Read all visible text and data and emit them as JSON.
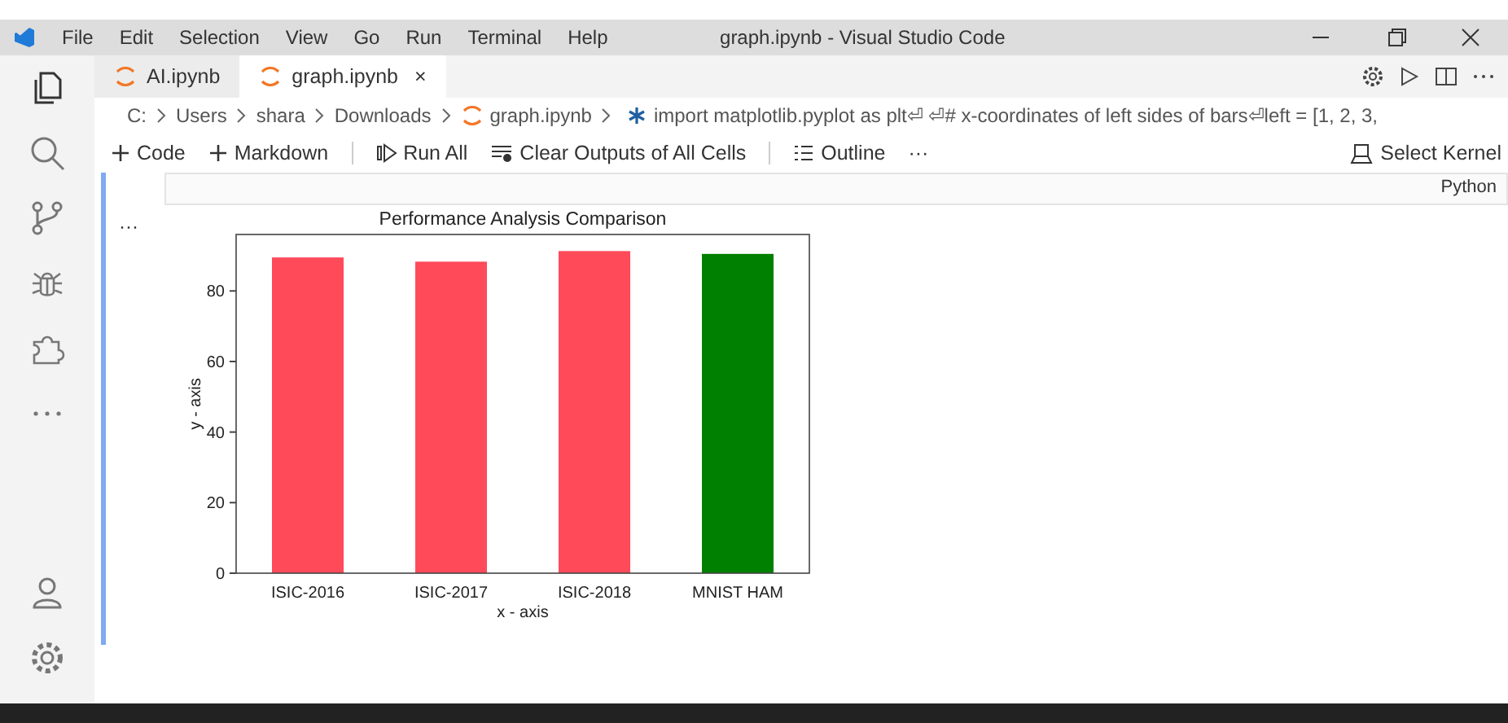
{
  "window": {
    "title": "graph.ipynb - Visual Studio Code"
  },
  "menu": [
    "File",
    "Edit",
    "Selection",
    "View",
    "Go",
    "Run",
    "Terminal",
    "Help"
  ],
  "tabs": [
    {
      "label": "AI.ipynb",
      "selected": false
    },
    {
      "label": "graph.ipynb",
      "selected": true,
      "close": "×"
    }
  ],
  "breadcrumbs": [
    "C:",
    "Users",
    "shara",
    "Downloads",
    "graph.ipynb",
    "import matplotlib.pyplot as plt⏎ ⏎# x-coordinates of left sides of bars⏎left = [1, 2, 3,"
  ],
  "toolbar": [
    {
      "kind": "add",
      "label": "Code"
    },
    {
      "kind": "add",
      "label": "Markdown"
    },
    {
      "kind": "sep"
    },
    {
      "kind": "run",
      "label": "Run All"
    },
    {
      "kind": "clear",
      "label": "Clear Outputs of All Cells"
    },
    {
      "kind": "sep"
    },
    {
      "kind": "outline",
      "label": "Outline"
    },
    {
      "kind": "more",
      "label": "···"
    }
  ],
  "kernel": "Select Kernel",
  "cell": {
    "language": "Python",
    "output_menu": "···",
    "chart_data": {
      "type": "bar",
      "title": "Performance Analysis Comparison",
      "xlabel": "x - axis",
      "ylabel": "y - axis",
      "categories": [
        "ISIC-2016",
        "ISIC-2017",
        "ISIC-2018",
        "MNIST HAM"
      ],
      "series": [
        {
          "color": "#ff4a5a",
          "values": [
            89.5,
            88.3,
            91.3,
            null
          ]
        },
        {
          "color": "#008000",
          "values": [
            null,
            null,
            null,
            90.5
          ]
        }
      ],
      "ylim": [
        0,
        96
      ],
      "yticks": [
        0,
        20,
        40,
        60,
        80
      ]
    }
  }
}
